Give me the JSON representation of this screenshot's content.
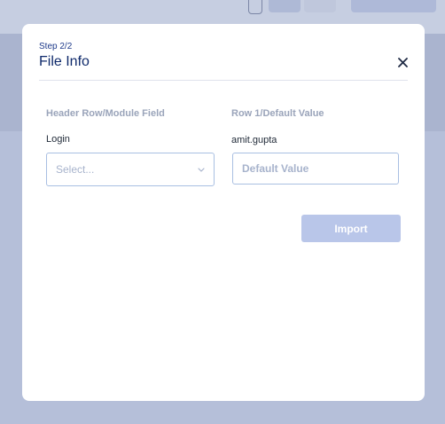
{
  "modal": {
    "step_label": "Step 2/2",
    "title": "File Info",
    "close_icon": "close-icon",
    "columns": {
      "left_header": "Header Row/Module Field",
      "right_header": "Row 1/Default Value"
    },
    "row": {
      "field_name": "Login",
      "default_value_text": "amit.gupta",
      "select": {
        "placeholder": "Select...",
        "icon": "chevron-down-icon"
      },
      "default_input": {
        "value": "",
        "placeholder": "Default Value"
      }
    },
    "import_button_label": "Import"
  },
  "colors": {
    "title": "#0f2a6b",
    "input_border": "#a9bfe2",
    "import_disabled": "#b9c6e9",
    "backdrop": "#b5bfd9"
  }
}
